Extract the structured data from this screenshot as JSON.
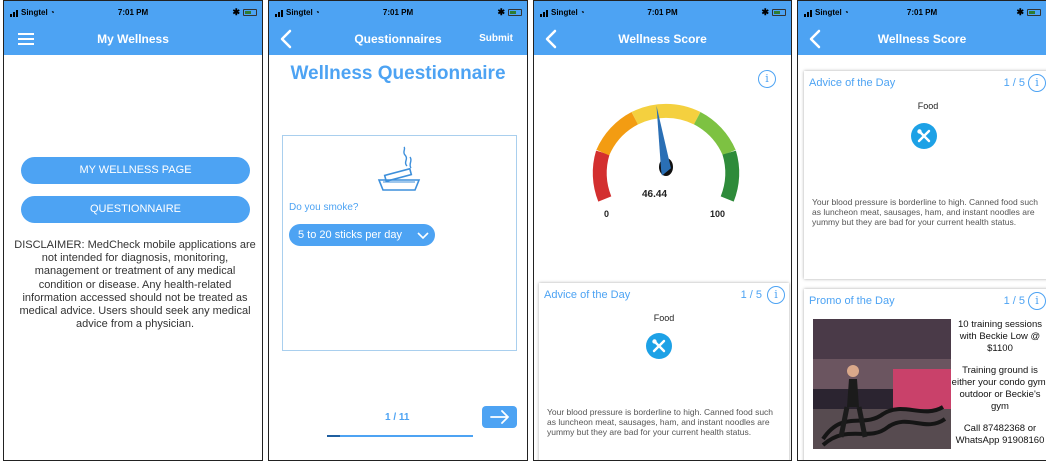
{
  "status": {
    "carrier": "Singtel",
    "time": "7:01 PM"
  },
  "screen1": {
    "title": "My Wellness",
    "btn_wellness": "MY WELLNESS PAGE",
    "btn_questionnaire": "QUESTIONNAIRE",
    "disclaimer": "DISCLAIMER: MedCheck mobile applications are not intended for diagnosis, monitoring, management or treatment of any medical condition or disease. Any health-related information accessed should not be treated as medical advice. Users should seek any medical advice from a physician."
  },
  "screen2": {
    "title": "Questionnaires",
    "submit": "Submit",
    "heading": "Wellness Questionnaire",
    "question": "Do you smoke?",
    "answer": "5 to 20 sticks per day",
    "page": "1 / 11",
    "progress": 0.09
  },
  "screen3": {
    "title": "Wellness Score",
    "score": "46.44",
    "score_value": 46.44,
    "min": "0",
    "max": "100",
    "advice": {
      "title": "Advice of the Day",
      "count": "1 / 5",
      "category": "Food",
      "text": "Your blood pressure is borderline to high. Canned food such as luncheon meat, sausages, ham, and instant noodles are yummy but they are bad for your current health status."
    }
  },
  "screen4": {
    "title": "Wellness Score",
    "advice": {
      "title": "Advice of the Day",
      "count": "1 / 5",
      "category": "Food",
      "text": "Your blood pressure is borderline to high. Canned food such as luncheon meat, sausages, ham, and instant noodles are yummy but they are bad for your current health status."
    },
    "promo": {
      "title": "Promo of the Day",
      "count": "1 / 5",
      "line1": "10 training sessions with Beckie Low @ $1100",
      "line2": "Training ground is either your condo gym, outdoor or Beckie's gym",
      "line3": "Call 87482368 or WhatsApp 91908160"
    }
  },
  "colors": {
    "accent": "#4da3f3",
    "food_icon": "#1da1e6"
  }
}
